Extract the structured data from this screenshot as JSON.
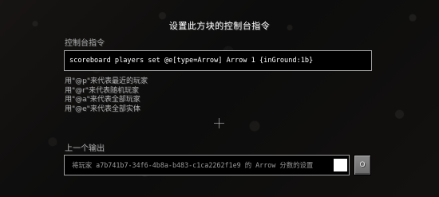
{
  "screen": {
    "title": "设置此方块的控制台指令"
  },
  "command": {
    "label": "控制台指令",
    "value": "scoreboard players set @e[type=Arrow] Arrow 1 {inGround:1b}"
  },
  "help": [
    "用\"@p\"来代表最近的玩家",
    "用\"@r\"来代表随机玩家",
    "用\"@a\"来代表全部玩家",
    "用\"@e\"来代表全部实体"
  ],
  "output": {
    "label": "上一个输出",
    "text": "将玩家 a7b741b7-34f6-4b8a-b483-c1ca2262f1e9 的 Arrow 分数的设置",
    "toggle_label": "O"
  },
  "icons": {
    "crosshair": "crosshair-icon"
  }
}
